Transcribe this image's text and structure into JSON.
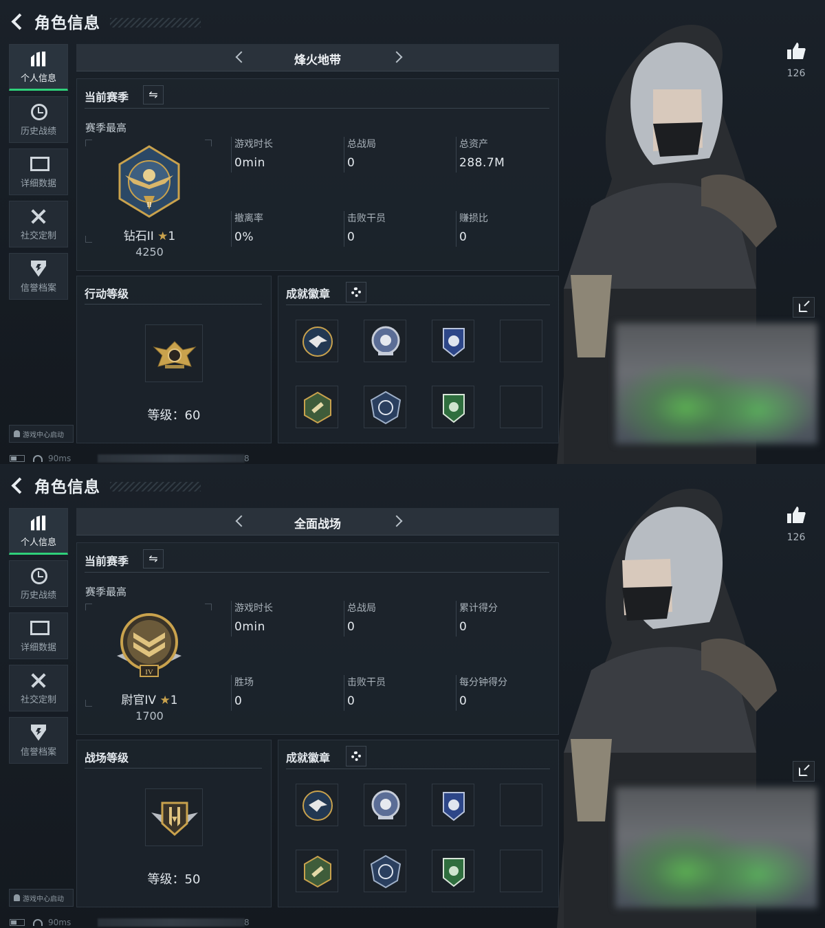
{
  "header_title": "角色信息",
  "sidebar": {
    "items": [
      {
        "label": "个人信息",
        "icon": "bar-chart-icon"
      },
      {
        "label": "历史战绩",
        "icon": "clock-icon"
      },
      {
        "label": "详细数据",
        "icon": "screen-icon"
      },
      {
        "label": "社交定制",
        "icon": "tools-icon"
      },
      {
        "label": "信誉档案",
        "icon": "shield-icon"
      }
    ],
    "launch_label": "游戏中心启动"
  },
  "status_bar": {
    "ping": "90ms",
    "num": "8"
  },
  "like_count": "126",
  "screens": [
    {
      "mode_title": "烽火地带",
      "season_title": "当前赛季",
      "season_best": "赛季最高",
      "rank_name": "钻石II",
      "rank_stars": "1",
      "rank_score": "4250",
      "stats": [
        {
          "label": "游戏时长",
          "value": "0min"
        },
        {
          "label": "总战局",
          "value": "0"
        },
        {
          "label": "总资产",
          "value": "288.7M"
        },
        {
          "label": "撤离率",
          "value": "0%"
        },
        {
          "label": "击败干员",
          "value": "0"
        },
        {
          "label": "赚损比",
          "value": "0"
        }
      ],
      "level_title": "行动等级",
      "level_text": "等级：60",
      "badges_title": "成就徽章"
    },
    {
      "mode_title": "全面战场",
      "season_title": "当前赛季",
      "season_best": "赛季最高",
      "rank_name": "尉官IV",
      "rank_stars": "1",
      "rank_score": "1700",
      "stats": [
        {
          "label": "游戏时长",
          "value": "0min"
        },
        {
          "label": "总战局",
          "value": "0"
        },
        {
          "label": "累计得分",
          "value": "0"
        },
        {
          "label": "胜场",
          "value": "0"
        },
        {
          "label": "击败干员",
          "value": "0"
        },
        {
          "label": "每分钟得分",
          "value": "0"
        }
      ],
      "level_title": "战场等级",
      "level_text": "等级：50",
      "badges_title": "成就徽章"
    }
  ],
  "colors": {
    "accent": "#2fd17a",
    "gold": "#c9a24d",
    "bg": "#161c23"
  }
}
